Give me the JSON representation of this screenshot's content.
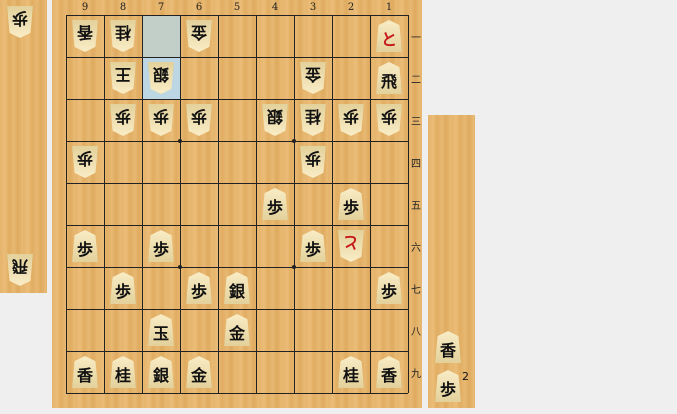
{
  "board": {
    "files": [
      "9",
      "8",
      "7",
      "6",
      "5",
      "4",
      "3",
      "2",
      "1"
    ],
    "ranks": [
      "一",
      "二",
      "三",
      "四",
      "五",
      "六",
      "七",
      "八",
      "九"
    ],
    "highlight_squares": [
      {
        "file": 7,
        "rank": 1,
        "type": "from"
      },
      {
        "file": 7,
        "rank": 2,
        "type": "to"
      }
    ],
    "pieces": [
      {
        "file": 9,
        "rank": 1,
        "glyph": "香",
        "owner": "gote"
      },
      {
        "file": 8,
        "rank": 1,
        "glyph": "桂",
        "owner": "gote"
      },
      {
        "file": 6,
        "rank": 1,
        "glyph": "金",
        "owner": "gote"
      },
      {
        "file": 1,
        "rank": 1,
        "glyph": "と",
        "owner": "sente",
        "promoted": true
      },
      {
        "file": 8,
        "rank": 2,
        "glyph": "王",
        "owner": "gote"
      },
      {
        "file": 7,
        "rank": 2,
        "glyph": "銀",
        "owner": "gote"
      },
      {
        "file": 3,
        "rank": 2,
        "glyph": "金",
        "owner": "gote"
      },
      {
        "file": 1,
        "rank": 2,
        "glyph": "飛",
        "owner": "sente"
      },
      {
        "file": 8,
        "rank": 3,
        "glyph": "歩",
        "owner": "gote"
      },
      {
        "file": 7,
        "rank": 3,
        "glyph": "歩",
        "owner": "gote"
      },
      {
        "file": 6,
        "rank": 3,
        "glyph": "歩",
        "owner": "gote"
      },
      {
        "file": 4,
        "rank": 3,
        "glyph": "銀",
        "owner": "gote"
      },
      {
        "file": 3,
        "rank": 3,
        "glyph": "桂",
        "owner": "gote"
      },
      {
        "file": 2,
        "rank": 3,
        "glyph": "歩",
        "owner": "gote"
      },
      {
        "file": 1,
        "rank": 3,
        "glyph": "歩",
        "owner": "gote"
      },
      {
        "file": 9,
        "rank": 4,
        "glyph": "歩",
        "owner": "gote"
      },
      {
        "file": 3,
        "rank": 4,
        "glyph": "歩",
        "owner": "gote"
      },
      {
        "file": 4,
        "rank": 5,
        "glyph": "歩",
        "owner": "sente"
      },
      {
        "file": 2,
        "rank": 5,
        "glyph": "歩",
        "owner": "sente"
      },
      {
        "file": 9,
        "rank": 6,
        "glyph": "歩",
        "owner": "sente"
      },
      {
        "file": 7,
        "rank": 6,
        "glyph": "歩",
        "owner": "sente"
      },
      {
        "file": 3,
        "rank": 6,
        "glyph": "歩",
        "owner": "sente"
      },
      {
        "file": 2,
        "rank": 6,
        "glyph": "と",
        "owner": "gote",
        "promoted": true
      },
      {
        "file": 8,
        "rank": 7,
        "glyph": "歩",
        "owner": "sente"
      },
      {
        "file": 6,
        "rank": 7,
        "glyph": "歩",
        "owner": "sente"
      },
      {
        "file": 5,
        "rank": 7,
        "glyph": "銀",
        "owner": "sente"
      },
      {
        "file": 1,
        "rank": 7,
        "glyph": "歩",
        "owner": "sente"
      },
      {
        "file": 7,
        "rank": 8,
        "glyph": "玉",
        "owner": "sente"
      },
      {
        "file": 5,
        "rank": 8,
        "glyph": "金",
        "owner": "sente"
      },
      {
        "file": 9,
        "rank": 9,
        "glyph": "香",
        "owner": "sente"
      },
      {
        "file": 8,
        "rank": 9,
        "glyph": "桂",
        "owner": "sente"
      },
      {
        "file": 7,
        "rank": 9,
        "glyph": "銀",
        "owner": "sente"
      },
      {
        "file": 6,
        "rank": 9,
        "glyph": "金",
        "owner": "sente"
      },
      {
        "file": 2,
        "rank": 9,
        "glyph": "桂",
        "owner": "sente"
      },
      {
        "file": 1,
        "rank": 9,
        "glyph": "香",
        "owner": "sente"
      }
    ]
  },
  "gote_hand": [
    {
      "glyph": "歩",
      "count": ""
    },
    {
      "glyph": "飛",
      "count": ""
    }
  ],
  "sente_hand": [
    {
      "glyph": "香",
      "count": ""
    },
    {
      "glyph": "歩",
      "count": "2"
    }
  ],
  "colors": {
    "promoted": "#c61a1a",
    "highlight_to": "#bcd7e3",
    "highlight_from": "#c2cfc8"
  }
}
